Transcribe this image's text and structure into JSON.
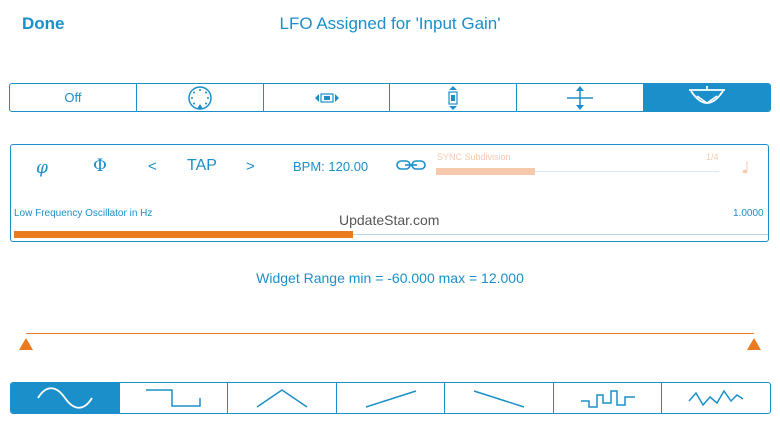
{
  "header": {
    "done_label": "Done",
    "title": "LFO Assigned for 'Input Gain'"
  },
  "mode_selector": {
    "off_label": "Off",
    "items": [
      "off",
      "knob-icon",
      "horizontal-range-icon",
      "vertical-range-icon",
      "vertical-arrows-icon",
      "pendulum-icon"
    ],
    "selected_index": 5
  },
  "lfo_panel": {
    "phase_symbol": "φ",
    "phase_reset_symbol": "Φ",
    "prev_label": "<",
    "tap_label": "TAP",
    "next_label": ">",
    "bpm_label": "BPM: 120.00",
    "sync_label": "SYNC Subdivision",
    "sync_value": "1/4",
    "lfo_label": "Low Frequency Oscillator in Hz",
    "lfo_value": "1.0000",
    "lfo_fill_fraction": 0.45,
    "sync_fill_fraction": 0.35
  },
  "watermark": "UpdateStar.com",
  "range_text": "Widget Range min = -60.000 max = 12.000",
  "waveforms": {
    "items": [
      "sine-wave-icon",
      "square-wave-icon",
      "triangle-wave-icon",
      "ramp-up-icon",
      "ramp-down-icon",
      "random-step-icon",
      "random-smooth-icon"
    ],
    "selected_index": 0
  },
  "colors": {
    "accent": "#1a8fc9",
    "orange": "#ea7b1e",
    "sync_disabled": "#f6c9ad",
    "background": "#ffffff"
  }
}
